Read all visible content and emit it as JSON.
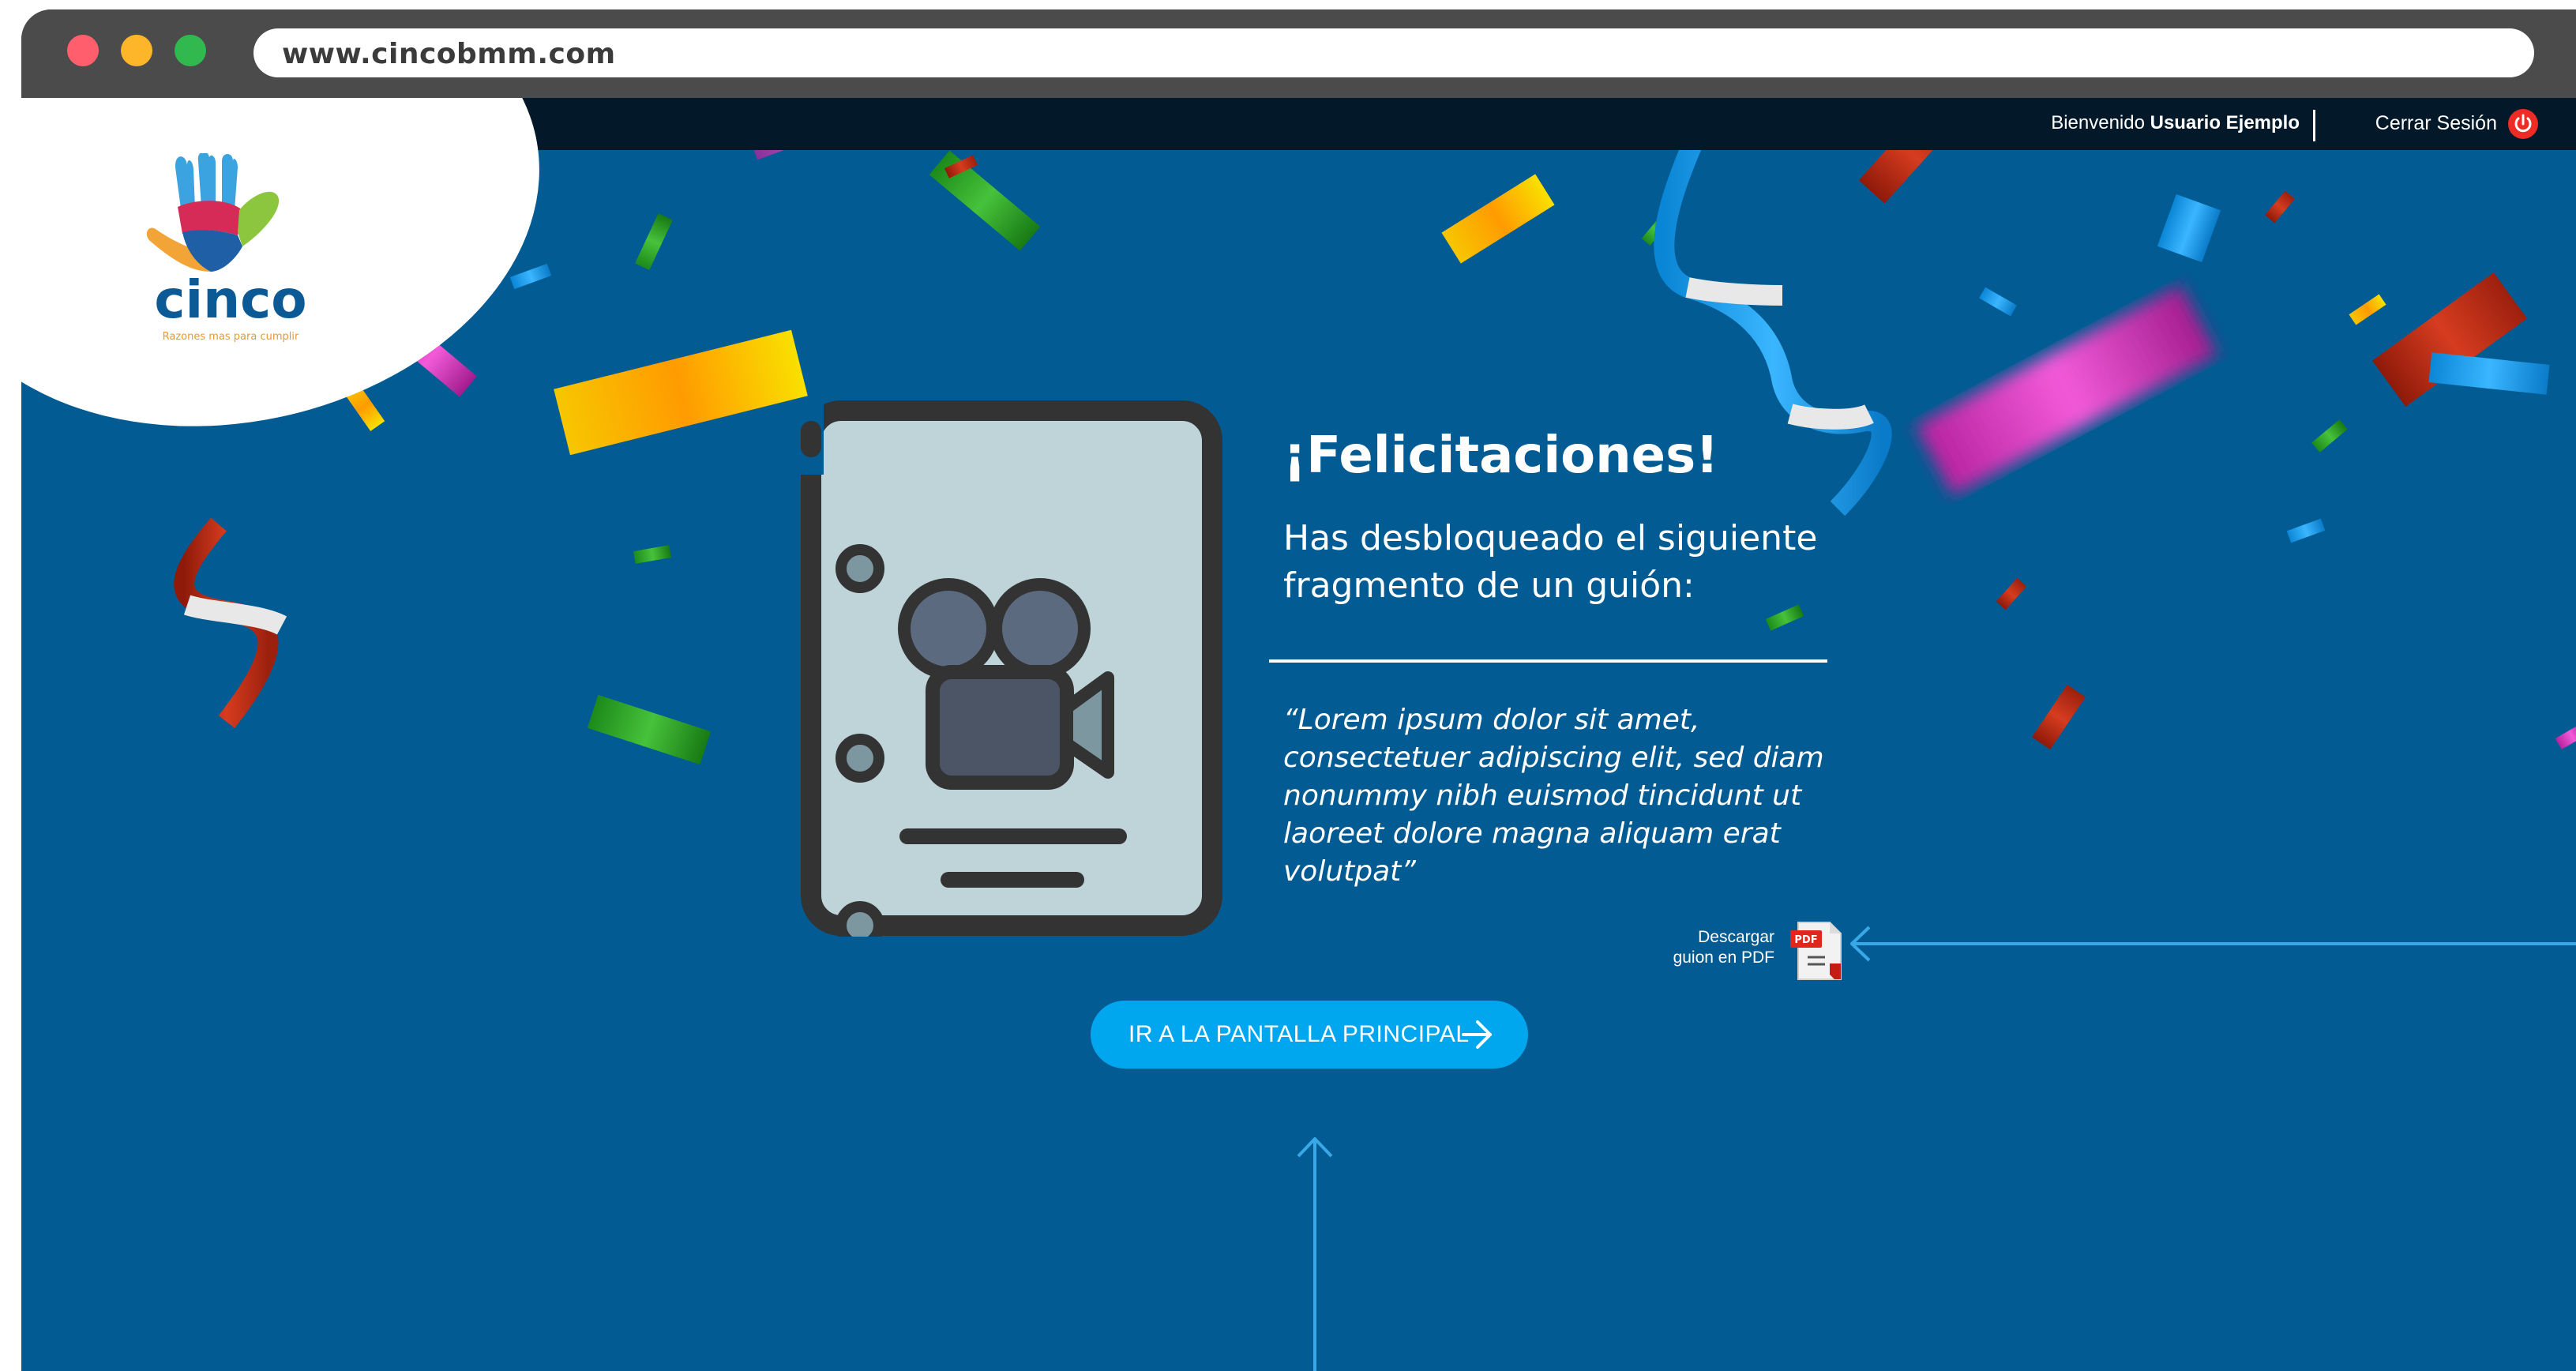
{
  "browser": {
    "url": "www.cincobmm.com"
  },
  "topnav": {
    "welcome_prefix": "Bienvenido",
    "user_name": "Usuario Ejemplo",
    "logout_label": "Cerrar Sesión"
  },
  "logo": {
    "brand": "cinco",
    "tagline": "Razones mas para cumplir"
  },
  "main": {
    "title": "¡Felicitaciones!",
    "subtitle": "Has desbloqueado el siguiente fragmento de un guión:",
    "quote": "“Lorem ipsum dolor sit amet, consectetuer adipiscing elit, sed diam nonummy nibh euismod tincidunt ut laoreet dolore magna aliquam erat volutpat”",
    "download_label_line1": "Descargar",
    "download_label_line2": "guion en PDF",
    "pdf_badge": "PDF",
    "cta_label": "IR A LA PANTALLA PRINCIPAL"
  },
  "colors": {
    "background": "#025b92",
    "topnav": "#03192a",
    "button": "#00a6ee",
    "power": "#ee2b25"
  },
  "icons": [
    "power-icon",
    "script-video-icon",
    "pdf-icon",
    "arrow-right-icon"
  ]
}
